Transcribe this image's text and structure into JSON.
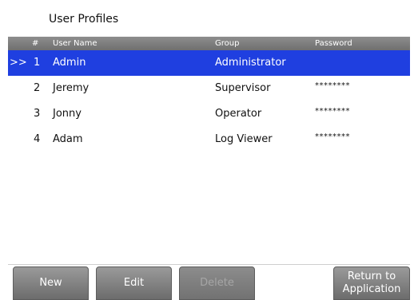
{
  "header": {
    "title": "User Profiles"
  },
  "table": {
    "columns": {
      "num": "#",
      "name": "User Name",
      "group": "Group",
      "password": "Password"
    },
    "rows": [
      {
        "marker": ">>",
        "num": "1",
        "name": "Admin",
        "group": "Administrator",
        "password": ""
      },
      {
        "marker": "",
        "num": "2",
        "name": "Jeremy",
        "group": "Supervisor",
        "password": "********"
      },
      {
        "marker": "",
        "num": "3",
        "name": "Jonny",
        "group": "Operator",
        "password": "********"
      },
      {
        "marker": "",
        "num": "4",
        "name": "Adam",
        "group": "Log Viewer",
        "password": "********"
      }
    ]
  },
  "footer": {
    "new_label": "New",
    "edit_label": "Edit",
    "delete_label": "Delete",
    "return_label": "Return to Application"
  },
  "colors": {
    "selection": "#1f3fe0",
    "header_bar": "#7f7f7f",
    "button": "#7d7d7d"
  }
}
